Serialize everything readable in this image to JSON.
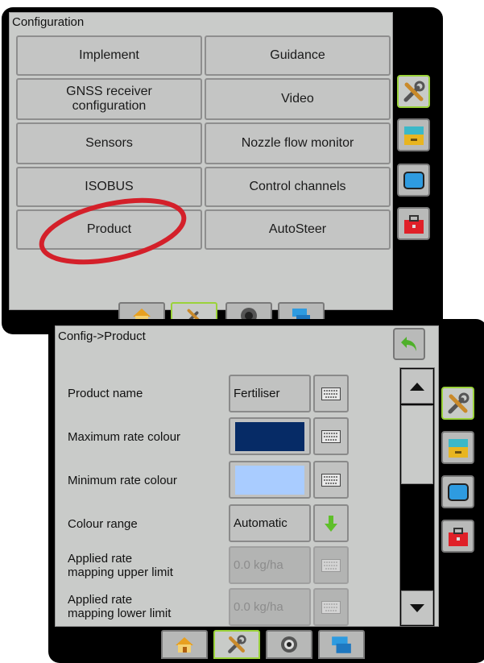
{
  "config_screen": {
    "title": "Configuration",
    "buttons": {
      "implement": "Implement",
      "guidance": "Guidance",
      "gnss_line1": "GNSS receiver",
      "gnss_line2": "configuration",
      "video": "Video",
      "sensors": "Sensors",
      "nozzle_flow_monitor": "Nozzle flow monitor",
      "isobus": "ISOBUS",
      "control_channels": "Control channels",
      "product": "Product",
      "autosteer": "AutoSteer"
    }
  },
  "product_screen": {
    "title": "Config->Product",
    "rows": [
      {
        "label": "Product name",
        "value": "Fertiliser"
      },
      {
        "label": "Maximum rate colour",
        "color": "#062b66"
      },
      {
        "label": "Minimum rate colour",
        "color": "#a9ccff"
      },
      {
        "label": "Colour range",
        "value": "Automatic"
      },
      {
        "label_line1": "Applied rate",
        "label_line2": "mapping upper limit",
        "value": "0.0 kg/ha"
      },
      {
        "label_line1": "Applied rate",
        "label_line2": "mapping lower limit",
        "value": "0.0 kg/ha"
      }
    ],
    "scroll_position": 0.0
  },
  "colors": {
    "active_tab": "#9ad23a",
    "highlight_circle": "#d4202a",
    "back_arrow": "#4fb02a"
  },
  "icons": [
    "tools-icon",
    "drawer-icon",
    "screen-icon",
    "toolbox-icon",
    "home-icon",
    "camera-icon",
    "console-icon",
    "back-arrow-icon",
    "keyboard-icon",
    "down-arrow-icon",
    "scroll-up-icon",
    "scroll-down-icon"
  ]
}
